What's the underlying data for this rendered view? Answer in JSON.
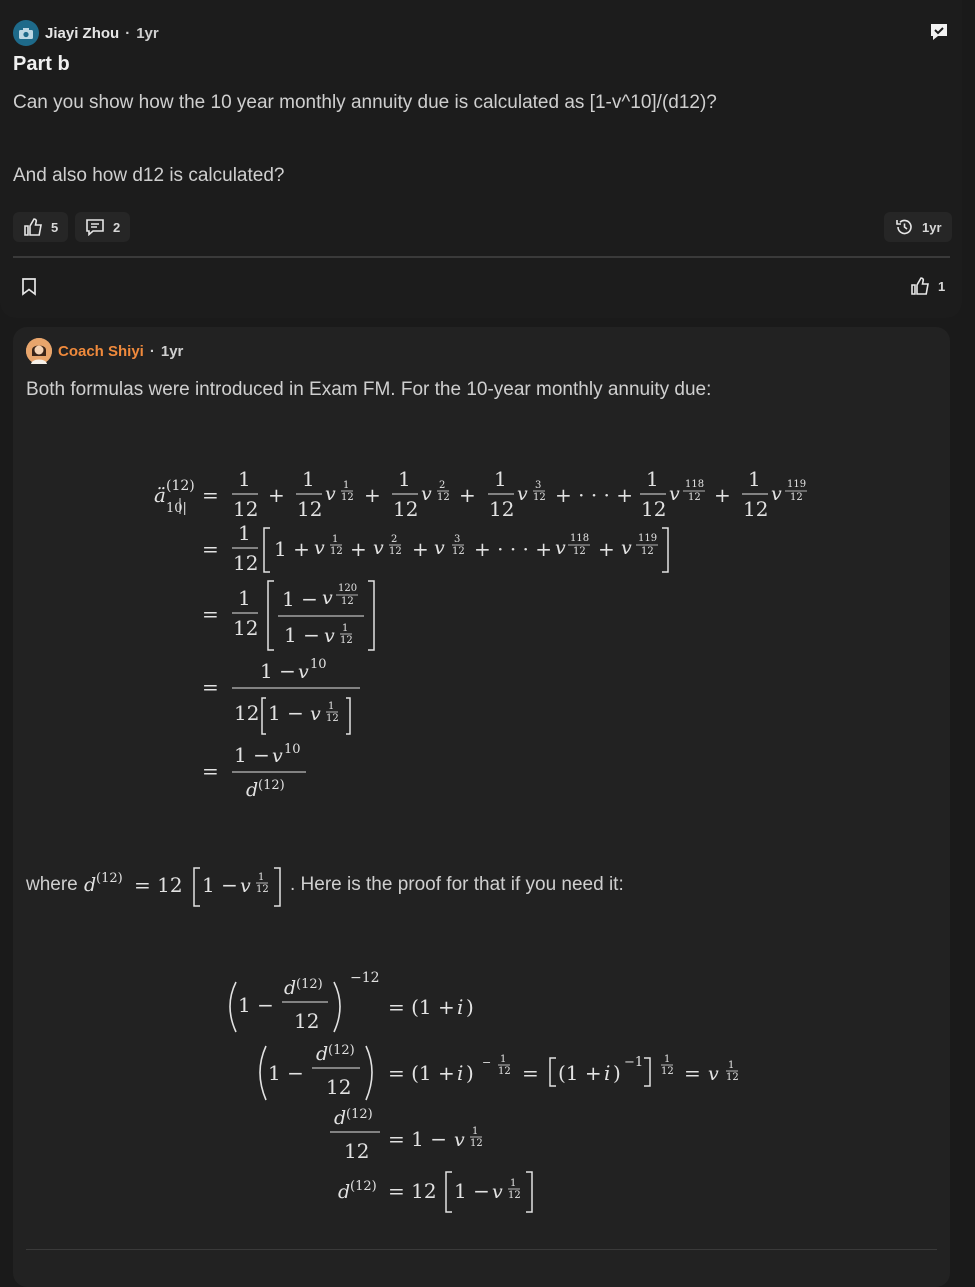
{
  "question": {
    "author": "Jiayi Zhou",
    "separator": "·",
    "time": "1yr",
    "title": "Part b",
    "line1": "Can you show how the 10 year monthly annuity due is calculated as [1-v^10]/(d12)?",
    "line2": "And also how d12 is calculated?",
    "upvotes": "5",
    "comments": "2",
    "history_time": "1yr",
    "answer_likes": "1"
  },
  "answer": {
    "author": "Coach Shiyi",
    "separator": "·",
    "time": "1yr",
    "intro": "Both formulas were introduced in Exam FM. For the 10-year monthly annuity due:",
    "where_prefix": "where",
    "where_suffix": ". Here is the proof for that if you need it:"
  },
  "icons": {
    "camera": "camera-icon",
    "flag": "check-flag-icon",
    "thumbs": "thumbs-up-icon",
    "comment": "comment-icon",
    "history": "history-icon",
    "bookmark": "bookmark-icon"
  },
  "colors": {
    "accent_orange": "#f08a3c",
    "background": "#1a1a1a",
    "card": "#222222"
  }
}
